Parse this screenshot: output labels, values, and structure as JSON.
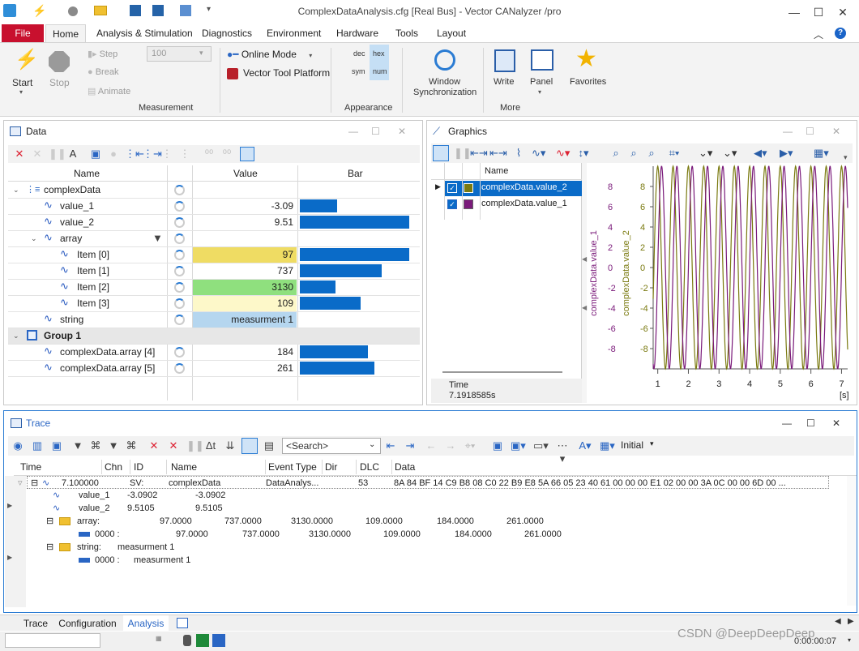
{
  "window": {
    "title": "ComplexDataAnalysis.cfg [Real Bus] - Vector CANalyzer /pro"
  },
  "ribbon": {
    "tabs": [
      "File",
      "Home",
      "Analysis & Stimulation",
      "Diagnostics",
      "Environment",
      "Hardware",
      "Tools",
      "Layout"
    ],
    "start": "Start",
    "stop": "Stop",
    "step": "Step",
    "break": "Break",
    "animate": "Animate",
    "animate_value": "100",
    "online_mode": "Online Mode",
    "vector_tool_platform": "Vector Tool Platform",
    "dec": "dec",
    "hex": "hex",
    "sym": "sym",
    "num": "num",
    "window_sync_1": "Window",
    "window_sync_2": "Synchronization",
    "write": "Write",
    "panel": "Panel",
    "favorites": "Favorites",
    "group_measurement": "Measurement",
    "group_appearance": "Appearance",
    "group_more": "More"
  },
  "data_window": {
    "title": "Data",
    "columns": [
      "Name",
      "Value",
      "Bar"
    ],
    "rows": [
      {
        "name": "complexData",
        "value": "",
        "bar": 0
      },
      {
        "name": "value_1",
        "value": "-3.09",
        "bar": 0.34
      },
      {
        "name": "value_2",
        "value": "9.51",
        "bar": 0.99
      },
      {
        "name": "array",
        "value": "",
        "bar": 0
      },
      {
        "name": "Item [0]",
        "value": "97",
        "bar": 0.99
      },
      {
        "name": "Item [1]",
        "value": "737",
        "bar": 0.74
      },
      {
        "name": "Item [2]",
        "value": "3130",
        "bar": 0.32
      },
      {
        "name": "Item [3]",
        "value": "109",
        "bar": 0.55
      },
      {
        "name": "string",
        "value": "measurment 1",
        "bar": 0
      },
      {
        "name": "Group 1",
        "value": "",
        "bar": 0
      },
      {
        "name": "complexData.array [4]",
        "value": "184",
        "bar": 0.62
      },
      {
        "name": "complexData.array [5]",
        "value": "261",
        "bar": 0.68
      }
    ]
  },
  "graphics_window": {
    "title": "Graphics",
    "name_header": "Name",
    "signals": [
      "complexData.value_2",
      "complexData.value_1"
    ],
    "signal_colors": [
      "#7a7a10",
      "#7a1a7a"
    ],
    "time_label": "Time",
    "time_value": "7.1918585s",
    "y_axis_label_1": "complexData.value_1",
    "y_axis_label_2": "complexData.value_2",
    "y_ticks": [
      "8",
      "6",
      "4",
      "2",
      "0",
      "-2",
      "-4",
      "-6",
      "-8"
    ],
    "x_ticks": [
      "1",
      "2",
      "3",
      "4",
      "5",
      "6",
      "7"
    ],
    "x_unit": "[s]"
  },
  "trace_window": {
    "title": "Trace",
    "search_placeholder": "<Search>",
    "initial": "Initial",
    "columns": [
      "Time",
      "Chn",
      "ID",
      "Name",
      "Event Type",
      "Dir",
      "DLC",
      "Data"
    ],
    "main_row": {
      "time": "7.100000",
      "chn": "SV:",
      "name": "complexData",
      "event_type": "DataAnalys...",
      "dlc": "53",
      "data": "8A 84 BF 14 C9 B8 08 C0 22 B9 E8 5A 66 05 23 40 61 00 00 00 E1 02 00 00 3A 0C 00 00 6D 00 ..."
    },
    "sub_rows": [
      {
        "label": "value_1",
        "v1": "-3.0902",
        "v2": "-3.0902"
      },
      {
        "label": "value_2",
        "v1": "9.5105",
        "v2": "9.5105"
      }
    ],
    "array_label": "array:",
    "array_values": [
      "97.0000",
      "737.0000",
      "3130.0000",
      "109.0000",
      "184.0000",
      "261.0000"
    ],
    "array_sub_label": "0000 :",
    "array_sub_values": [
      "97.0000",
      "737.0000",
      "3130.0000",
      "109.0000",
      "184.0000",
      "261.0000"
    ],
    "string_label": "string:",
    "string_value": "measurment 1",
    "string_sub_label": "0000 :",
    "string_sub_value": "measurment 1"
  },
  "bottom_tabs": [
    "Trace",
    "Configuration",
    "Analysis"
  ],
  "status": {
    "watermark": "CSDN @DeepDeepDeep",
    "time": "0:00:00:07"
  }
}
